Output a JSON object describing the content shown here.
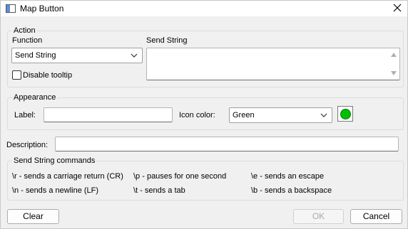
{
  "window": {
    "title": "Map Button"
  },
  "action": {
    "group_title": "Action",
    "function_label": "Function",
    "function_value": "Send String",
    "send_string_label": "Send String",
    "send_string_value": "",
    "disable_tooltip_label": "Disable tooltip",
    "disable_tooltip_checked": false
  },
  "appearance": {
    "group_title": "Appearance",
    "label_label": "Label:",
    "label_value": "",
    "icon_color_label": "Icon color:",
    "icon_color_value": "Green",
    "swatch_color": "#00c000"
  },
  "description": {
    "label": "Description:",
    "value": ""
  },
  "commands": {
    "group_title": "Send String commands",
    "rows": [
      [
        "\\r - sends a carriage return (CR)",
        "\\p - pauses for one second",
        "\\e - sends an escape"
      ],
      [
        "\\n - sends a newline (LF)",
        "\\t - sends a tab",
        "\\b - sends a backspace"
      ]
    ]
  },
  "buttons": {
    "clear": "Clear",
    "ok": "OK",
    "cancel": "Cancel"
  }
}
